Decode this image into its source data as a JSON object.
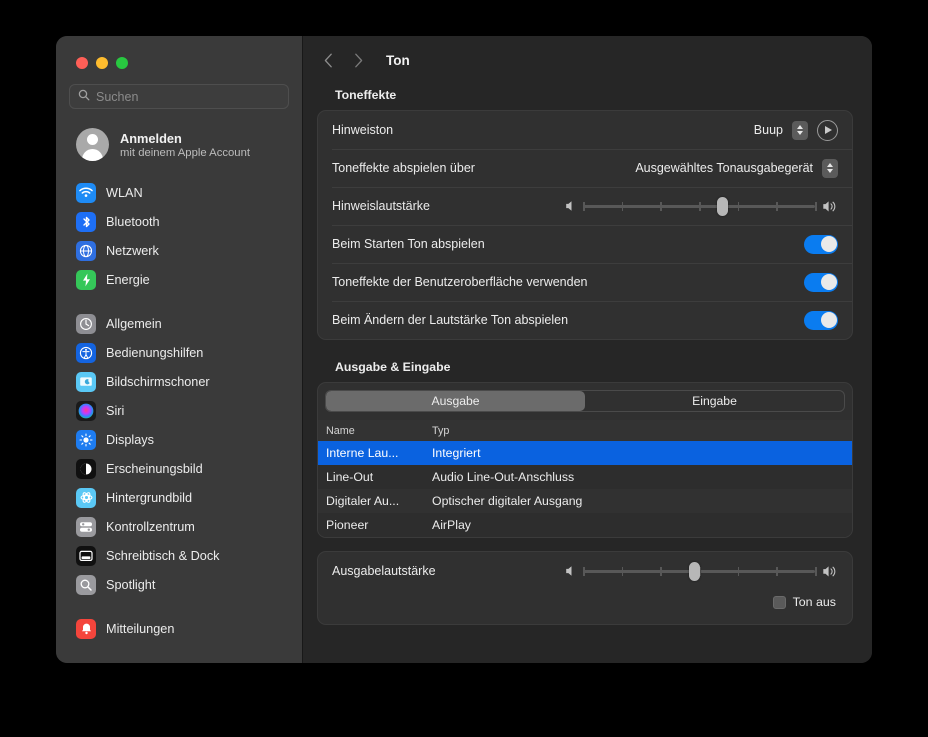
{
  "window": {
    "traffic_lights": [
      "close",
      "minimize",
      "zoom"
    ],
    "colors": {
      "close": "#ff5f57",
      "minimize": "#febc2e",
      "zoom": "#28c840",
      "accent": "#0a7cf0",
      "selection": "#0a62e0"
    }
  },
  "sidebar": {
    "search": {
      "placeholder": "Suchen",
      "value": ""
    },
    "account": {
      "title": "Anmelden",
      "subtitle": "mit deinem Apple Account"
    },
    "groups": [
      {
        "items": [
          {
            "label": "WLAN",
            "icon": "wifi-icon",
            "color": "#1e8bf5"
          },
          {
            "label": "Bluetooth",
            "icon": "bluetooth-icon",
            "color": "#1e6ff5"
          },
          {
            "label": "Netzwerk",
            "icon": "globe-icon",
            "color": "#2f6fe0"
          },
          {
            "label": "Energie",
            "icon": "bolt-icon",
            "color": "#35c759"
          }
        ]
      },
      {
        "items": [
          {
            "label": "Allgemein",
            "icon": "gear-icon",
            "color": "#8e8e93"
          },
          {
            "label": "Bedienungshilfen",
            "icon": "accessibility-icon",
            "color": "#1464e0"
          },
          {
            "label": "Bildschirmschoner",
            "icon": "screensaver-icon",
            "color": "#5ac8f5"
          },
          {
            "label": "Siri",
            "icon": "siri-icon",
            "color": "#1a1a1a"
          },
          {
            "label": "Displays",
            "icon": "display-icon",
            "color": "#1e7cf0"
          },
          {
            "label": "Erscheinungsbild",
            "icon": "appearance-icon",
            "color": "#101010"
          },
          {
            "label": "Hintergrundbild",
            "icon": "wallpaper-icon",
            "color": "#5ac8f5"
          },
          {
            "label": "Kontrollzentrum",
            "icon": "control-center-icon",
            "color": "#9a9a9e"
          },
          {
            "label": "Schreibtisch & Dock",
            "icon": "dock-icon",
            "color": "#101010"
          },
          {
            "label": "Spotlight",
            "icon": "spotlight-icon",
            "color": "#9a9a9e"
          }
        ]
      },
      {
        "items": [
          {
            "label": "Mitteilungen",
            "icon": "bell-icon",
            "color": "#f4453c"
          }
        ]
      }
    ]
  },
  "toolbar": {
    "back": "back-chevron",
    "forward": "forward-chevron",
    "title": "Ton"
  },
  "sections": {
    "sound_effects": {
      "header": "Toneffekte",
      "alert_sound": {
        "label": "Hinweiston",
        "value": "Buup",
        "play_button": "play-icon"
      },
      "play_through": {
        "label": "Toneffekte abspielen über",
        "value": "Ausgewähltes Tonausgabegerät"
      },
      "alert_volume": {
        "label": "Hinweislautstärke",
        "percent": 60
      },
      "toggles": [
        {
          "label": "Beim Starten Ton abspielen",
          "on": true
        },
        {
          "label": "Toneffekte der Benutzeroberfläche verwenden",
          "on": true
        },
        {
          "label": "Beim Ändern der Lautstärke Ton abspielen",
          "on": true
        }
      ]
    },
    "output_input": {
      "header": "Ausgabe & Eingabe",
      "tabs": [
        {
          "label": "Ausgabe",
          "active": true
        },
        {
          "label": "Eingabe",
          "active": false
        }
      ],
      "table": {
        "columns": [
          "Name",
          "Typ"
        ],
        "rows": [
          {
            "name": "Interne Lau...",
            "type": "Integriert",
            "selected": true
          },
          {
            "name": "Line-Out",
            "type": "Audio Line-Out-Anschluss",
            "selected": false
          },
          {
            "name": "Digitaler Au...",
            "type": "Optischer digitaler Ausgang",
            "selected": false
          },
          {
            "name": "Pioneer",
            "type": "AirPlay",
            "selected": false
          }
        ]
      },
      "output_volume": {
        "label": "Ausgabelautstärke",
        "percent": 48
      },
      "mute": {
        "label": "Ton aus",
        "checked": false
      }
    }
  }
}
